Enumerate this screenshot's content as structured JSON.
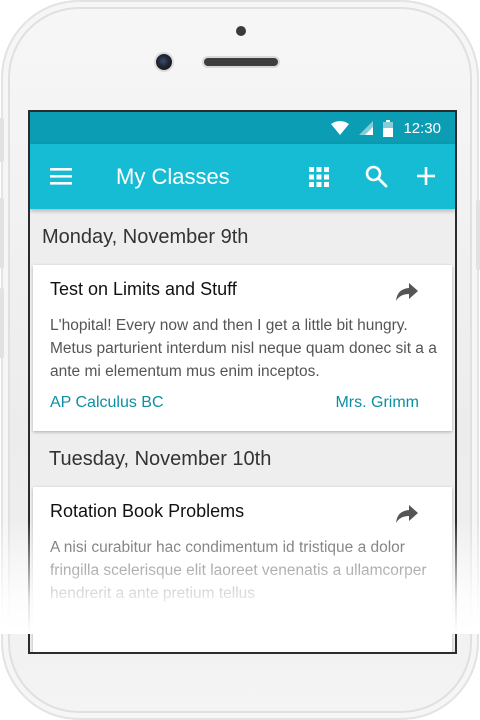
{
  "status_bar": {
    "time": "12:30",
    "icons": [
      "wifi-icon",
      "signal-icon",
      "battery-icon"
    ]
  },
  "app_bar": {
    "title": "My Classes",
    "icons": [
      "menu-icon",
      "grid-icon",
      "search-icon",
      "add-icon"
    ]
  },
  "days": [
    {
      "date": "Monday, November 9th",
      "assignments": [
        {
          "title": "Test on Limits and Stuff",
          "body": "L'hopital! Every now and then I get a little bit hungry. Metus parturient interdum nisl neque quam donec sit a a ante mi elementum mus enim inceptos.",
          "course": "AP Calculus BC",
          "teacher": "Mrs. Grimm"
        }
      ]
    },
    {
      "date": "Tuesday, November 10th",
      "assignments": [
        {
          "title": "Rotation Book Problems",
          "body": "A nisi curabitur hac condimentum id tristique a dolor fringilla scelerisque elit laoreet venenatis a ullamcorper hendrerit a ante pretium tellus"
        }
      ]
    }
  ],
  "colors": {
    "status_bar": "#0b9db3",
    "app_bar": "#16bcd4",
    "link": "#0c8fa3"
  }
}
